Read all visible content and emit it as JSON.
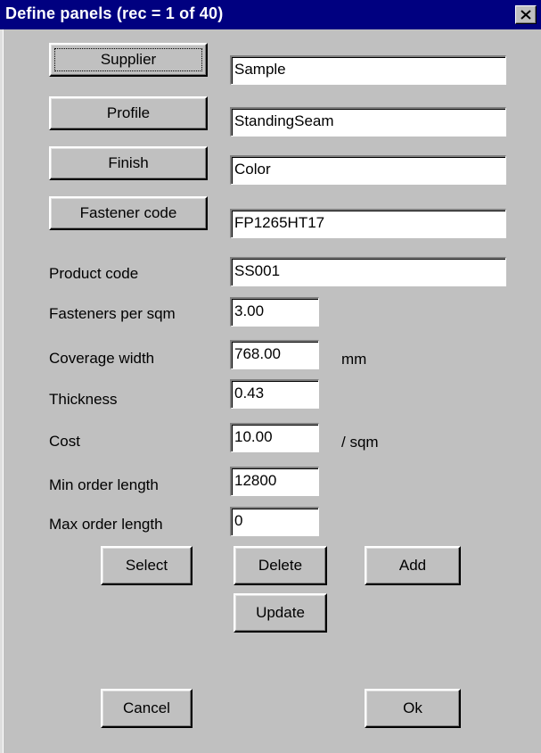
{
  "window": {
    "title": "Define panels (rec = 1 of 40)",
    "close_icon": "close-icon"
  },
  "buttons": {
    "supplier": "Supplier",
    "profile": "Profile",
    "finish": "Finish",
    "fastener_code": "Fastener code",
    "select": "Select",
    "delete": "Delete",
    "add": "Add",
    "update": "Update",
    "cancel": "Cancel",
    "ok": "Ok"
  },
  "fields": {
    "supplier": "Sample",
    "profile": "StandingSeam",
    "finish": "Color",
    "fastener_code": "FP1265HT17",
    "product_code": "SS001",
    "fasteners_per_sqm": "3.00",
    "coverage_width": "768.00",
    "thickness": "0.43",
    "cost": "10.00",
    "min_order_length": "12800",
    "max_order_length": "0"
  },
  "labels": {
    "product_code": "Product code",
    "fasteners_per_sqm": "Fasteners per sqm",
    "coverage_width": "Coverage width",
    "thickness": "Thickness",
    "cost": "Cost",
    "min_order_length": "Min order length",
    "max_order_length": "Max order length"
  },
  "units": {
    "coverage_width": "mm",
    "cost": "/ sqm"
  },
  "colors": {
    "titlebar": "#000080",
    "face": "#c0c0c0"
  }
}
